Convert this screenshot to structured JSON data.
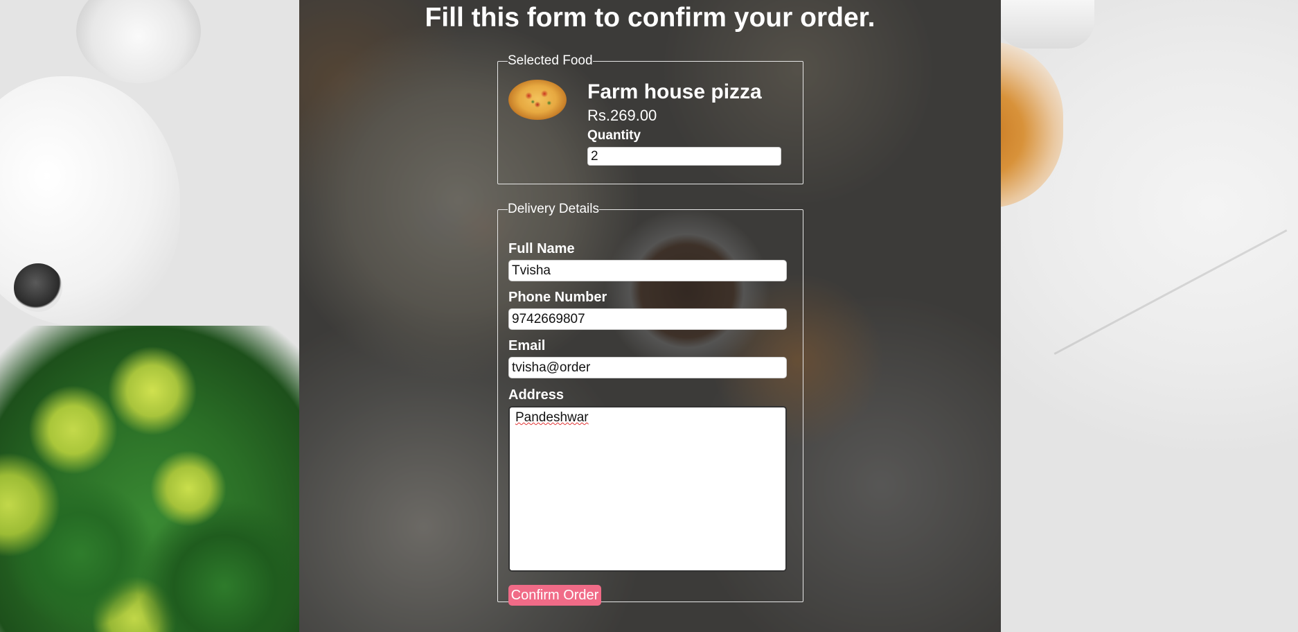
{
  "page": {
    "heading": "Fill this form to confirm your order."
  },
  "selected_food": {
    "legend": "Selected Food",
    "image_icon": "pizza-image",
    "name": "Farm house pizza",
    "price": "Rs.269.00",
    "quantity_label": "Quantity",
    "quantity_value": "2"
  },
  "delivery": {
    "legend": "Delivery Details",
    "full_name_label": "Full Name",
    "full_name_value": "Tvisha",
    "phone_label": "Phone Number",
    "phone_value": "9742669807",
    "email_label": "Email",
    "email_value": "tvisha@order",
    "address_label": "Address",
    "address_value": "Pandeshwar",
    "confirm_label": "Confirm Order"
  },
  "colors": {
    "button": "#f06b87",
    "text": "#ffffff",
    "overlay": "#3c3c3c"
  }
}
